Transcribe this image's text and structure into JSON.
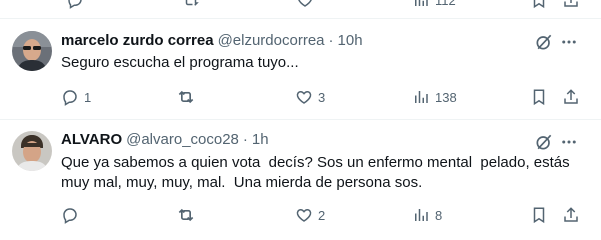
{
  "colors": {
    "text_primary": "#0f1419",
    "text_secondary": "#536471",
    "divider": "#eff3f4",
    "background": "#ffffff"
  },
  "top_partial_row": {
    "views_count": "112"
  },
  "tweets": [
    {
      "display_name": "marcelo zurdo correa",
      "handle": "@elzurdocorrea",
      "separator": "·",
      "time": "10h",
      "text": "Seguro escucha el programa tuyo...",
      "replies": "1",
      "reposts": "",
      "likes": "3",
      "views": "138",
      "icons": [
        "grok-icon",
        "more-icon",
        "reply-icon",
        "repost-icon",
        "like-icon",
        "views-icon",
        "bookmark-icon",
        "share-icon"
      ]
    },
    {
      "display_name": "ALVARO",
      "handle": "@alvaro_coco28",
      "separator": "·",
      "time": "1h",
      "text": "Que ya sabemos a quien vota  decís? Sos un enfermo mental  pelado, estás muy mal, muy, muy, mal.  Una mierda de persona sos.",
      "replies": "",
      "reposts": "",
      "likes": "2",
      "views": "8",
      "icons": [
        "grok-icon",
        "more-icon",
        "reply-icon",
        "repost-icon",
        "like-icon",
        "views-icon",
        "bookmark-icon",
        "share-icon"
      ]
    }
  ]
}
